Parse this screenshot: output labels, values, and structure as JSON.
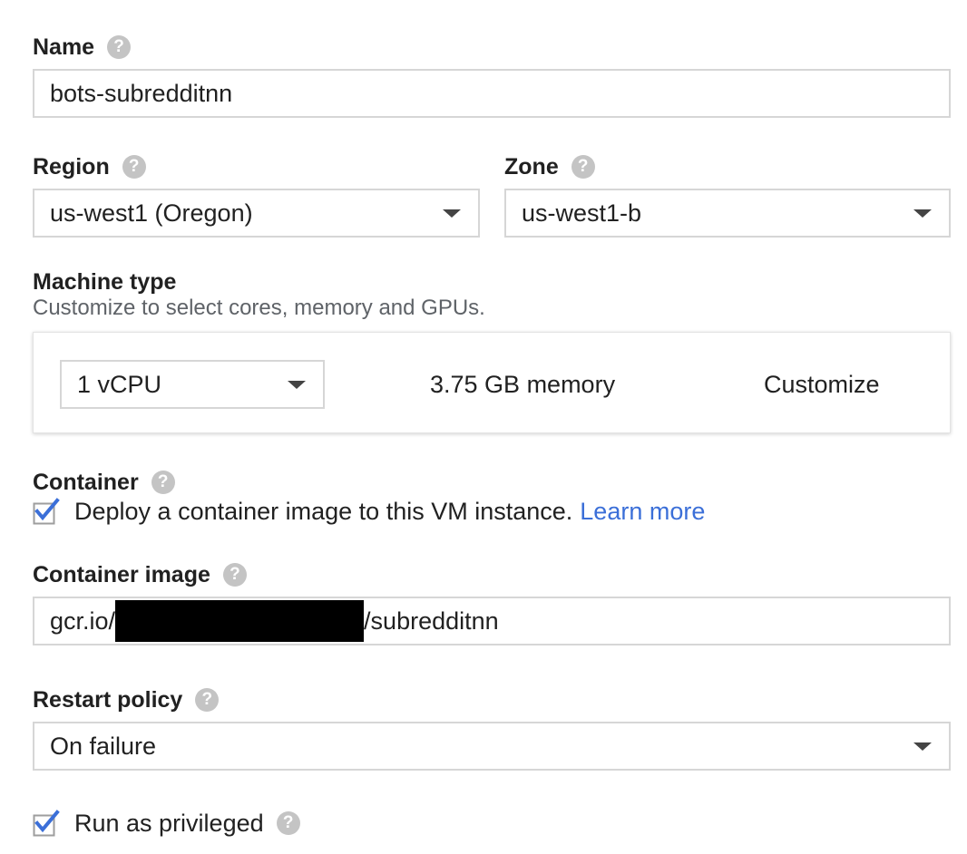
{
  "name": {
    "label": "Name",
    "value": "bots-subredditnn"
  },
  "region": {
    "label": "Region",
    "value": "us-west1 (Oregon)"
  },
  "zone": {
    "label": "Zone",
    "value": "us-west1-b"
  },
  "machine_type": {
    "label": "Machine type",
    "description": "Customize to select cores, memory and GPUs.",
    "cores_value": "1 vCPU",
    "memory": "3.75 GB memory",
    "customize_label": "Customize"
  },
  "container": {
    "label": "Container",
    "checkbox_checked": true,
    "checkbox_text": "Deploy a container image to this VM instance.",
    "learn_more": "Learn more"
  },
  "container_image": {
    "label": "Container image",
    "value_prefix": "gcr.io/",
    "value_suffix": "/subredditnn"
  },
  "restart_policy": {
    "label": "Restart policy",
    "value": "On failure"
  },
  "privileged": {
    "checked": true,
    "label": "Run as privileged"
  },
  "colors": {
    "link": "#3b6fd8",
    "checkmark": "#3b6fd8",
    "border": "#d6d6d6",
    "help_icon": "#c4c4c4"
  },
  "icons": {
    "help": "help-circle-icon",
    "dropdown": "caret-down-icon",
    "check": "checkmark-icon"
  }
}
